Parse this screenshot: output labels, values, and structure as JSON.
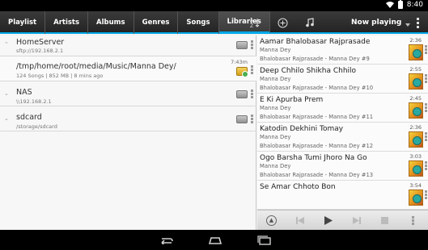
{
  "status": {
    "time": "8:40"
  },
  "tabs": [
    {
      "label": "Playlist"
    },
    {
      "label": "Artists"
    },
    {
      "label": "Albums"
    },
    {
      "label": "Genres"
    },
    {
      "label": "Songs"
    },
    {
      "label": "Libraries",
      "active": true
    }
  ],
  "toolbar": {
    "sort_icon": "A Z",
    "add_icon": "+",
    "music_icon": "♫",
    "now_playing_label": "Now playing",
    "accent_color": "#00a8e8"
  },
  "libraries": [
    {
      "name": "HomeServer",
      "path": "sftp://192.168.2.1",
      "icon": "server-icon",
      "expanded": true
    },
    {
      "name": "/tmp/home/root/media/Music/Manna Dey/",
      "path": "124 Songs | 852 MB | 8 mins ago",
      "time": "7:43m",
      "icon": "folder-icon"
    },
    {
      "name": "NAS",
      "path": "\\\\192.168.2.1",
      "icon": "nas-icon",
      "expanded": false
    },
    {
      "name": "sdcard",
      "path": "/storage/sdcard",
      "icon": "drive-icon",
      "expanded": false
    }
  ],
  "songs": [
    {
      "title": "Aamar Bhalobasar Rajprasade",
      "artist": "Manna Dey",
      "album": "Bhalobasar Rajprasade - Manna Dey #9",
      "duration": "2:36"
    },
    {
      "title": "Deep Chhilo Shikha Chhilo",
      "artist": "Manna Dey",
      "album": "Bhalobasar Rajprasade - Manna Dey #10",
      "duration": "2:55"
    },
    {
      "title": "E Ki Apurba Prem",
      "artist": "Manna Dey",
      "album": "Bhalobasar Rajprasade - Manna Dey #11",
      "duration": "2:45"
    },
    {
      "title": "Katodin Dekhini Tomay",
      "artist": "Manna Dey",
      "album": "Bhalobasar Rajprasade - Manna Dey #12",
      "duration": "2:36"
    },
    {
      "title": "Ogo Barsha Tumi Jhoro Na Go",
      "artist": "Manna Dey",
      "album": "Bhalobasar Rajprasade - Manna Dey #13",
      "duration": "3:03"
    },
    {
      "title": "Se Amar Chhoto Bon",
      "artist": "",
      "album": "",
      "duration": "3:54"
    }
  ],
  "player": {
    "up_icon": "▲",
    "prev_icon": "⏮",
    "play_icon": "▶",
    "next_icon": "⏭",
    "stop_icon": "■"
  }
}
